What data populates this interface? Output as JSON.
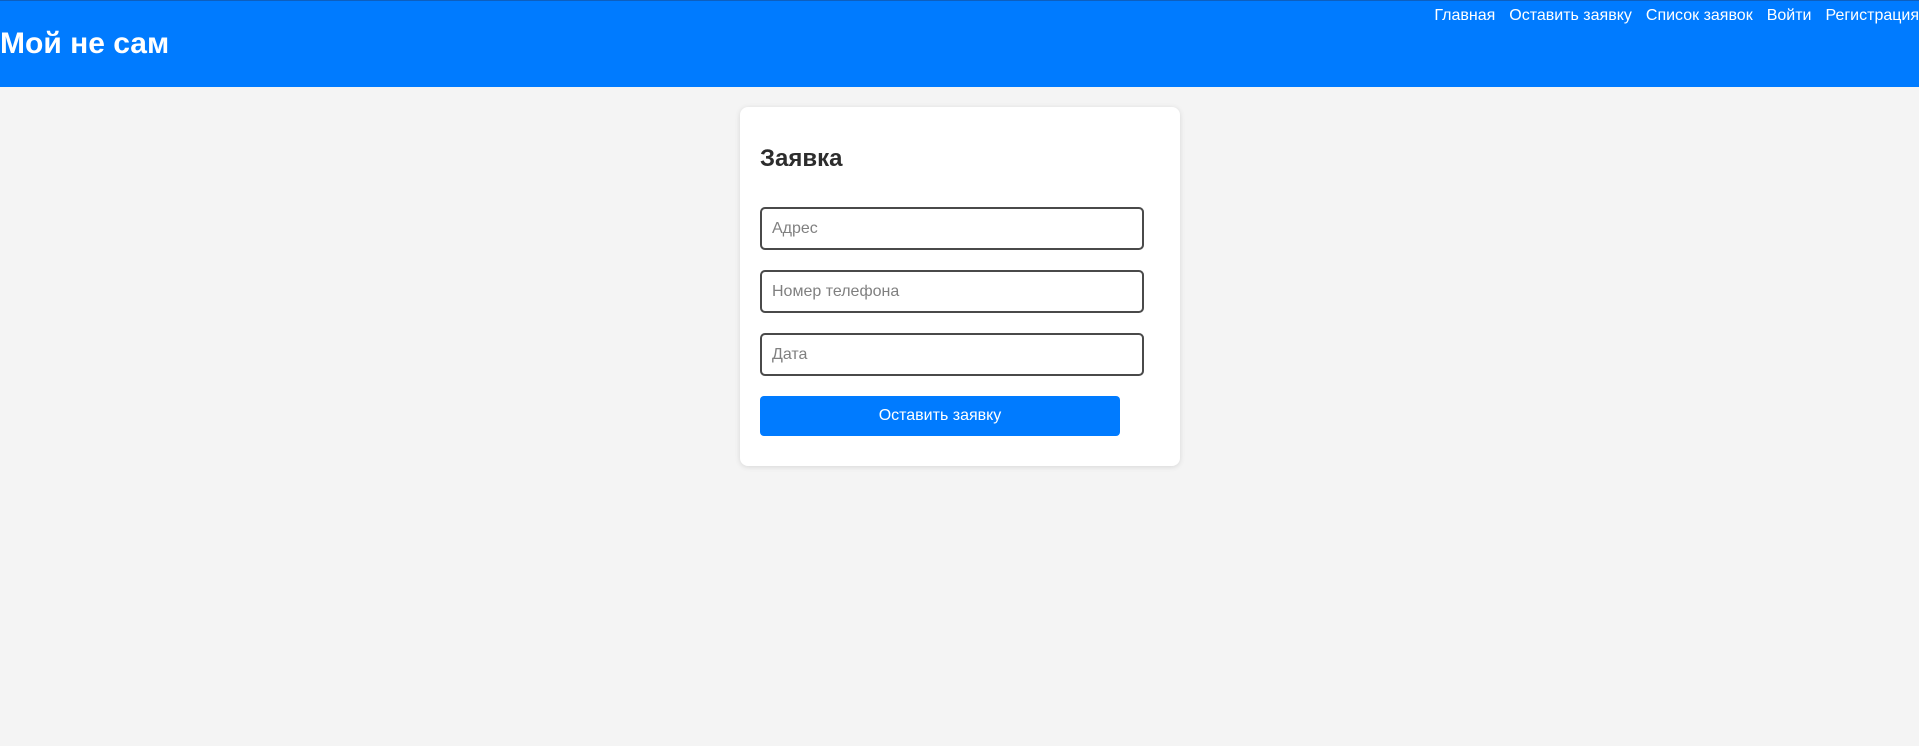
{
  "header": {
    "brand": "Мой не сам",
    "nav": [
      {
        "label": "Главная"
      },
      {
        "label": "Оставить заявку"
      },
      {
        "label": "Список заявок"
      },
      {
        "label": "Войти"
      },
      {
        "label": "Регистрация"
      }
    ]
  },
  "form": {
    "title": "Заявка",
    "fields": {
      "address": {
        "placeholder": "Адрес",
        "value": ""
      },
      "phone": {
        "placeholder": "Номер телефона",
        "value": ""
      },
      "date": {
        "placeholder": "Дата",
        "value": ""
      }
    },
    "submit_label": "Оставить заявку"
  },
  "colors": {
    "primary": "#007bff",
    "background": "#f4f4f4",
    "card": "#ffffff",
    "text_dark": "#2d2d2d"
  }
}
